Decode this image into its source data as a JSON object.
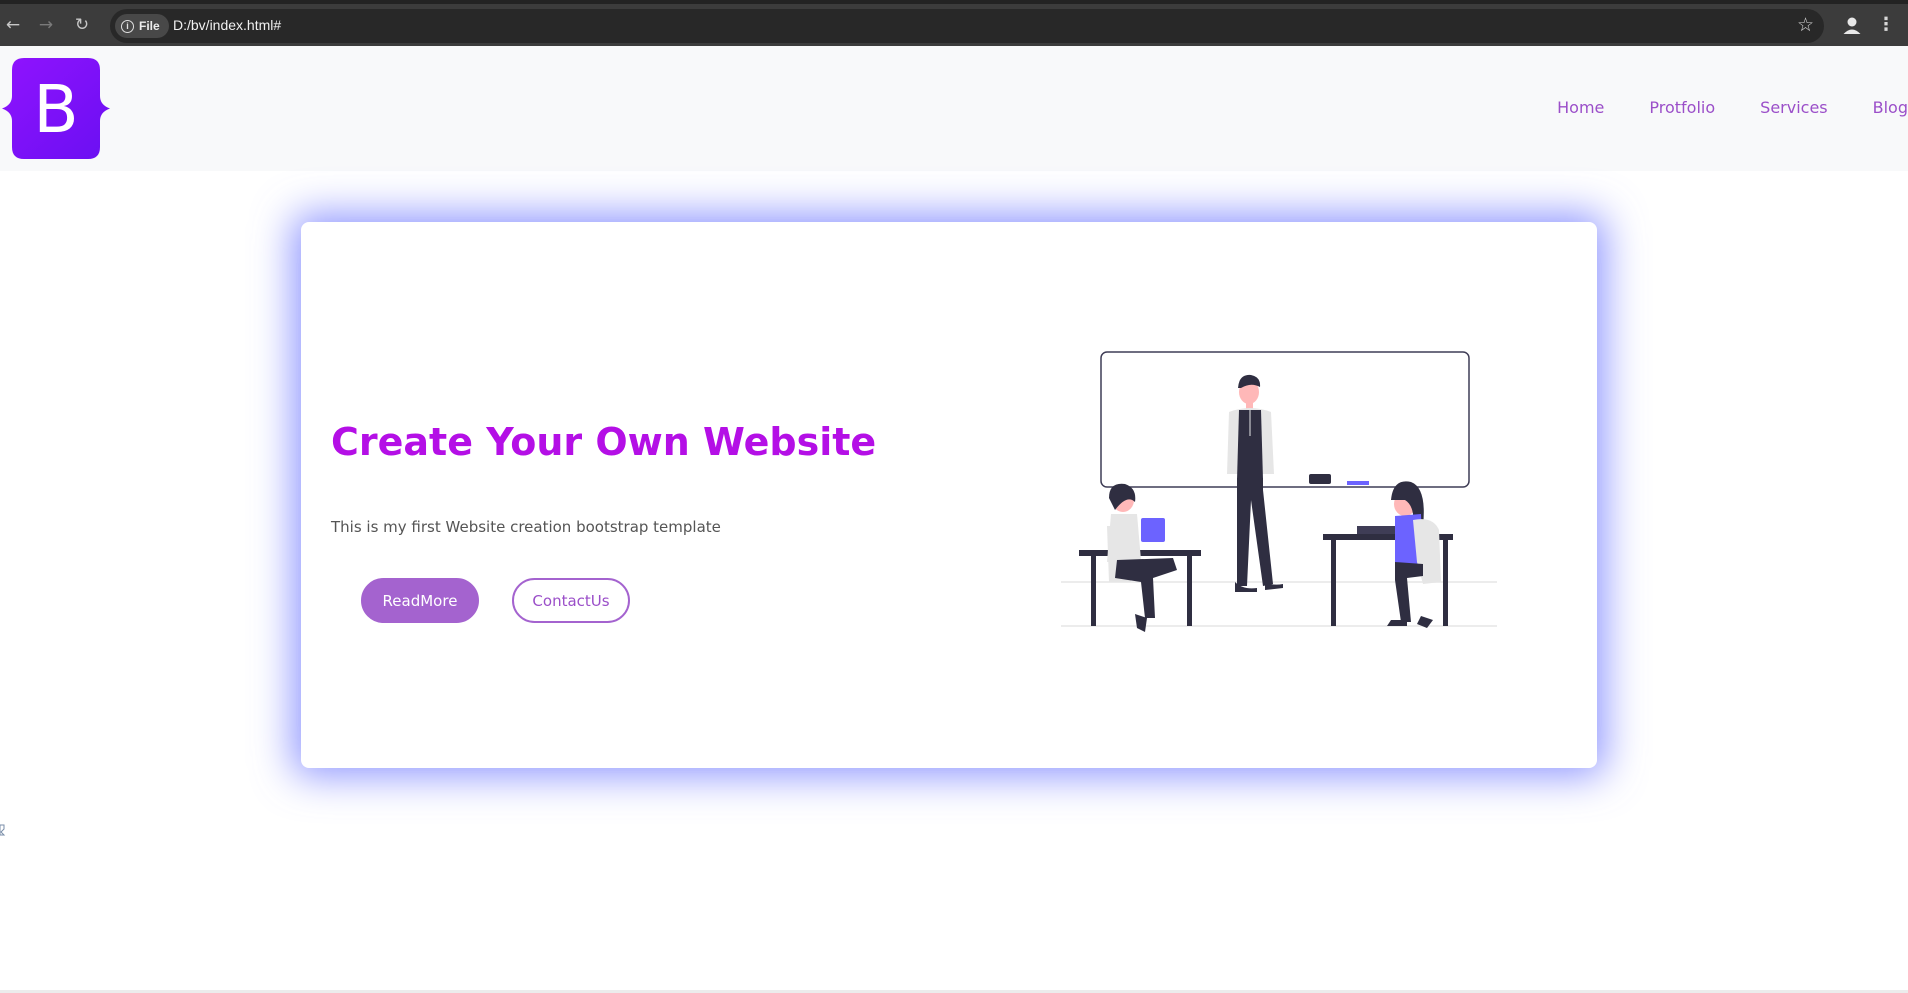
{
  "browser": {
    "back_icon": "back-arrow-icon",
    "forward_icon": "forward-arrow-icon",
    "reload_icon": "reload-icon",
    "file_chip_label": "File",
    "url": "D:/bv/index.html#",
    "bookmark_icon": "star-icon",
    "profile_icon": "profile-icon",
    "menu_icon": "kebab-menu-icon"
  },
  "navbar": {
    "logo_letter": "B",
    "links": [
      {
        "label": "Home"
      },
      {
        "label": "Protfolio"
      },
      {
        "label": "Services"
      },
      {
        "label": "Blog"
      }
    ]
  },
  "hero": {
    "title": "Create Your Own Website",
    "text": "This is my first Website creation bootstrap template",
    "primary_button": "ReadMore",
    "secondary_button": "ContactUs"
  },
  "colors": {
    "brand_purple": "#7d11f5",
    "title_purple": "#b40fe6",
    "link_purple": "#9b4fc9",
    "button_purple": "#a463cf",
    "glow_blue": "#5f69ff",
    "illustration_accent": "#6c63ff"
  }
}
